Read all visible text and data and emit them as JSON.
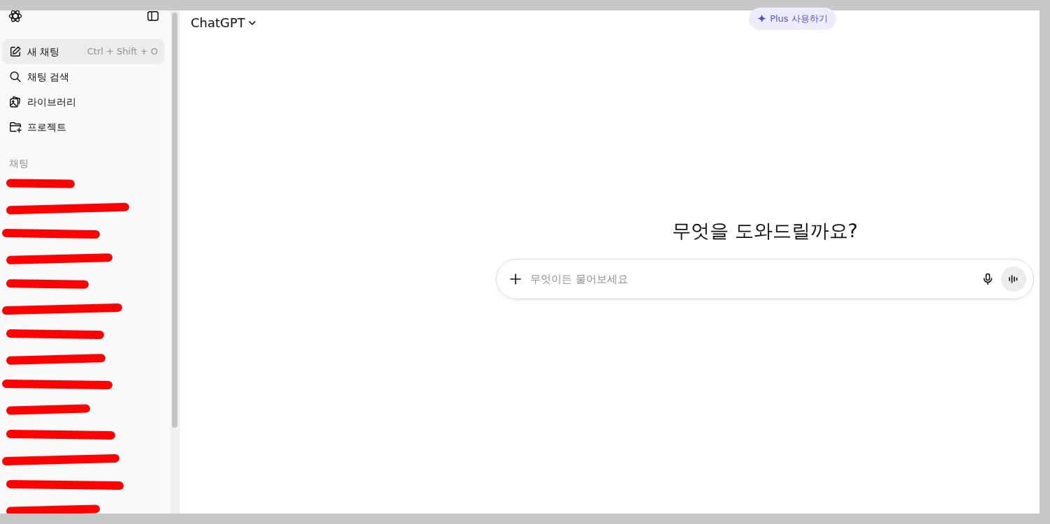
{
  "sidebar": {
    "nav": [
      {
        "label": "새 채팅",
        "shortcut": "Ctrl + Shift + O",
        "selected": true
      },
      {
        "label": "채팅 검색",
        "selected": false
      },
      {
        "label": "라이브러리",
        "selected": false
      },
      {
        "label": "프로젝트",
        "selected": false
      }
    ],
    "section_title": "채팅",
    "chats": [
      {
        "kind": "redacted"
      },
      {
        "kind": "redacted"
      },
      {
        "kind": "redacted"
      },
      {
        "kind": "redacted"
      },
      {
        "kind": "redacted"
      },
      {
        "kind": "redacted"
      },
      {
        "kind": "redacted"
      },
      {
        "kind": "redacted"
      },
      {
        "kind": "redacted"
      },
      {
        "kind": "redacted"
      },
      {
        "kind": "redacted"
      },
      {
        "kind": "redacted"
      },
      {
        "kind": "redacted"
      },
      {
        "kind": "redacted"
      }
    ]
  },
  "header": {
    "model": "ChatGPT",
    "upgrade": "Plus 사용하기"
  },
  "main": {
    "heading": "무엇을 도와드릴까요?",
    "composer": {
      "placeholder": "무엇이든 물어보세요"
    }
  }
}
